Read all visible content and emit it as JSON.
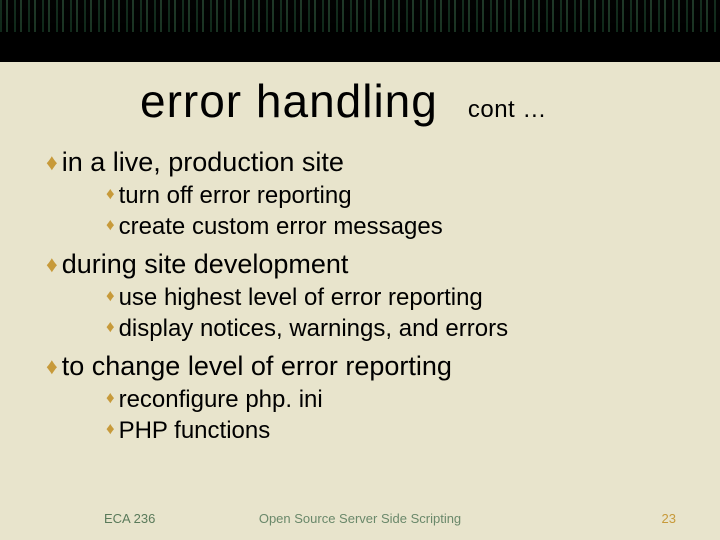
{
  "title": {
    "main": "error handling",
    "cont": "cont …"
  },
  "bullets": [
    {
      "text": "in a live, production site",
      "sub": [
        "turn off error reporting",
        "create custom error messages"
      ]
    },
    {
      "text": "during site development",
      "sub": [
        "use highest level of error reporting",
        "display notices, warnings, and errors"
      ]
    },
    {
      "text": "to change level of error reporting",
      "sub": [
        "reconfigure php. ini",
        "PHP functions"
      ]
    }
  ],
  "footer": {
    "left": "ECA 236",
    "center": "Open Source Server Side Scripting",
    "right": "23"
  }
}
